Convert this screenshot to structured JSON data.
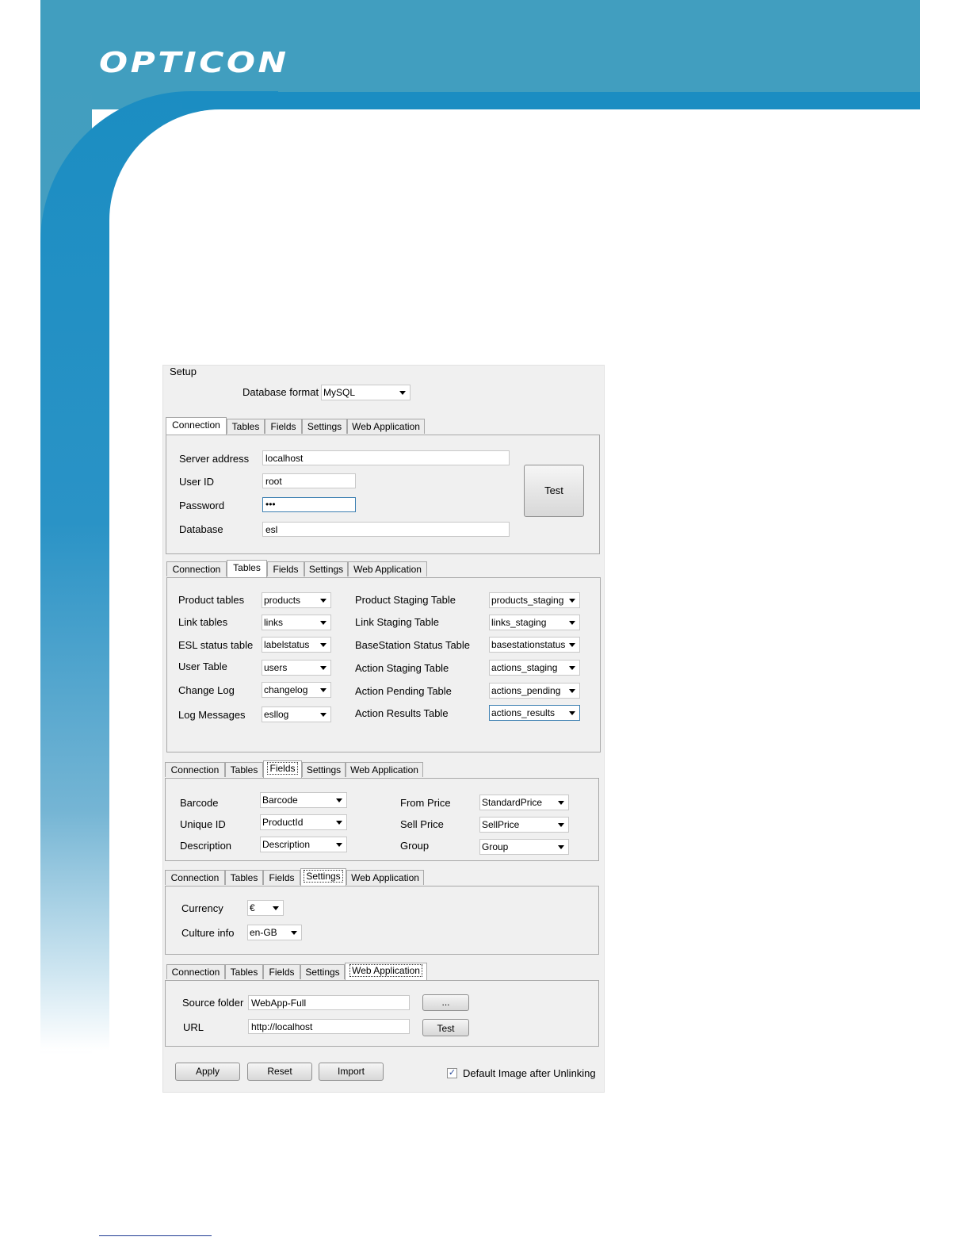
{
  "brand": {
    "logo_text": "OPTICON"
  },
  "setup": {
    "group_label": "Setup",
    "database_format_label": "Database format",
    "database_format_value": "MySQL"
  },
  "tab_labels": [
    "Connection",
    "Tables",
    "Fields",
    "Settings",
    "Web Application"
  ],
  "connection": {
    "server_address_label": "Server address",
    "server_address_value": "localhost",
    "user_id_label": "User ID",
    "user_id_value": "root",
    "password_label": "Password",
    "password_value": "•••",
    "database_label": "Database",
    "database_value": "esl",
    "test_label": "Test"
  },
  "tables": {
    "left": [
      {
        "label": "Product tables",
        "value": "products"
      },
      {
        "label": "Link tables",
        "value": "links"
      },
      {
        "label": "ESL status table",
        "value": "labelstatus"
      },
      {
        "label": "User Table",
        "value": "users"
      },
      {
        "label": "Change Log",
        "value": "changelog"
      },
      {
        "label": "Log Messages",
        "value": "esllog"
      }
    ],
    "right": [
      {
        "label": "Product Staging Table",
        "value": "products_staging"
      },
      {
        "label": "Link Staging Table",
        "value": "links_staging"
      },
      {
        "label": "BaseStation Status Table",
        "value": "basestationstatus"
      },
      {
        "label": "Action Staging Table",
        "value": "actions_staging"
      },
      {
        "label": "Action Pending Table",
        "value": "actions_pending"
      },
      {
        "label": "Action Results Table",
        "value": "actions_results"
      }
    ]
  },
  "fields": {
    "left": [
      {
        "label": "Barcode",
        "value": "Barcode"
      },
      {
        "label": "Unique ID",
        "value": "ProductId"
      },
      {
        "label": "Description",
        "value": "Description"
      }
    ],
    "right": [
      {
        "label": "From Price",
        "value": "StandardPrice"
      },
      {
        "label": "Sell Price",
        "value": "SellPrice"
      },
      {
        "label": "Group",
        "value": "Group"
      }
    ]
  },
  "settings": {
    "currency_label": "Currency",
    "currency_value": "€",
    "culture_label": "Culture info",
    "culture_value": "en-GB"
  },
  "web_application": {
    "source_folder_label": "Source folder",
    "source_folder_value": "WebApp-Full",
    "browse_label": "...",
    "url_label": "URL",
    "url_value": "http://localhost",
    "test_label": "Test"
  },
  "actions": {
    "apply_label": "Apply",
    "reset_label": "Reset",
    "import_label": "Import",
    "default_image_label": "Default Image after Unlinking",
    "default_image_checked": true
  }
}
